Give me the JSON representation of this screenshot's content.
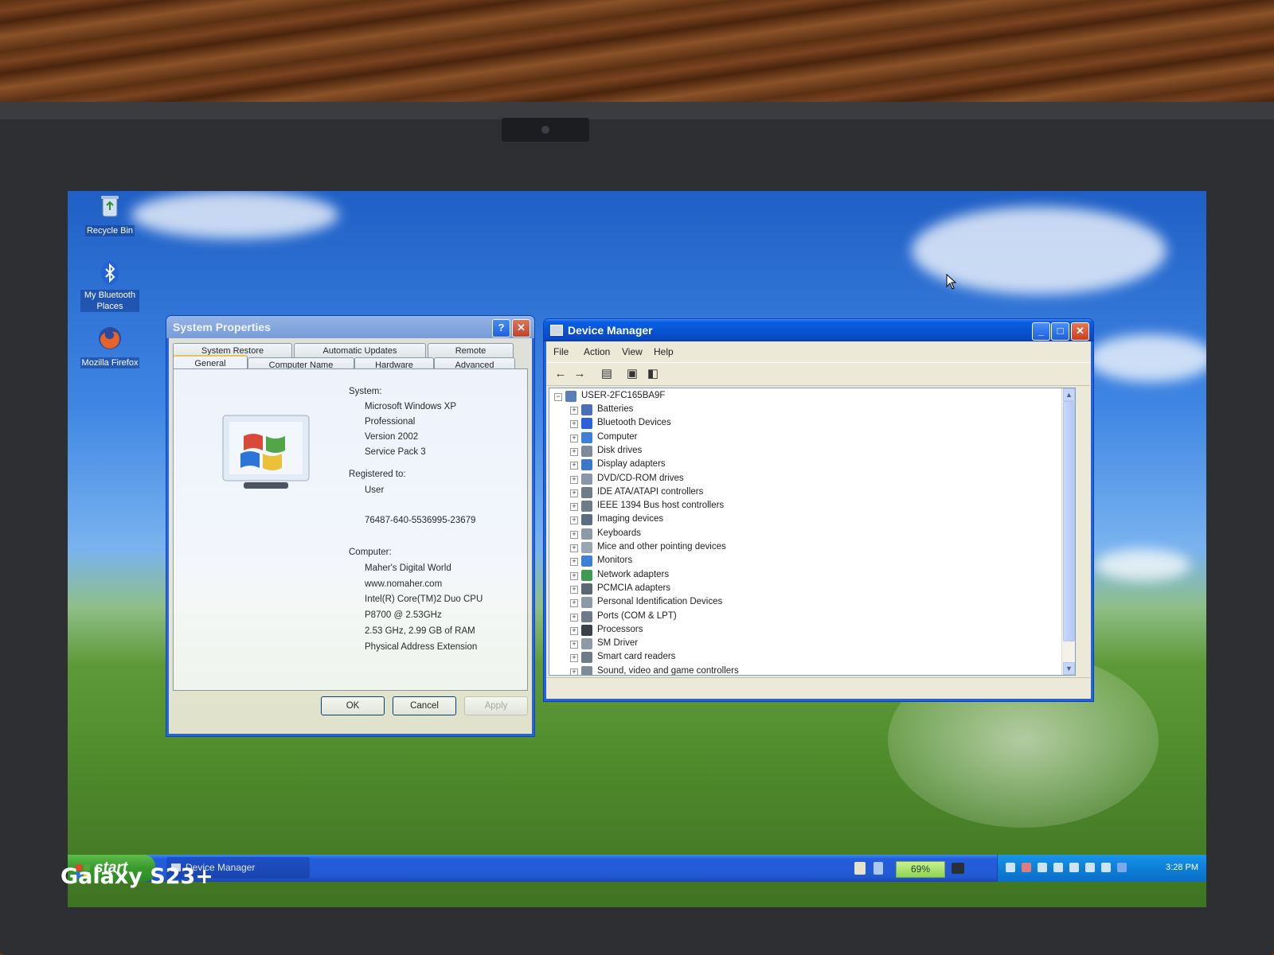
{
  "photo": {
    "watermark": "Galaxy S23+"
  },
  "desktop": {
    "icons": [
      {
        "label": "Recycle Bin",
        "icon": "recycle-bin-icon"
      },
      {
        "label": "My Bluetooth Places",
        "icon": "bluetooth-icon"
      },
      {
        "label": "Mozilla Firefox",
        "icon": "firefox-icon"
      }
    ]
  },
  "system_properties": {
    "title": "System Properties",
    "tabs_top": [
      "System Restore",
      "Automatic Updates",
      "Remote"
    ],
    "tabs_bottom": [
      "General",
      "Computer Name",
      "Hardware",
      "Advanced"
    ],
    "active_tab": "General",
    "system_heading": "System:",
    "system_lines": [
      "Microsoft Windows XP",
      "Professional",
      "Version 2002",
      "Service Pack 3"
    ],
    "registered_heading": "Registered to:",
    "registered_user": "User",
    "product_id": "76487-640-5536995-23679",
    "computer_heading": "Computer:",
    "computer_lines": [
      "Maher's Digital World",
      "www.nomaher.com",
      "Intel(R) Core(TM)2 Duo CPU",
      "P8700  @ 2.53GHz",
      "2.53 GHz, 2.99 GB of RAM",
      "Physical Address Extension"
    ],
    "buttons": {
      "ok": "OK",
      "cancel": "Cancel",
      "apply": "Apply"
    }
  },
  "device_manager": {
    "title": "Device Manager",
    "menu": [
      "File",
      "Action",
      "View",
      "Help"
    ],
    "root": "USER-2FC165BA9F",
    "items": [
      {
        "label": "Batteries",
        "color": "#4a6fb5"
      },
      {
        "label": "Bluetooth Devices",
        "color": "#2b62d9"
      },
      {
        "label": "Computer",
        "color": "#3f7fd6"
      },
      {
        "label": "Disk drives",
        "color": "#7f8a99"
      },
      {
        "label": "Display adapters",
        "color": "#3a78c9"
      },
      {
        "label": "DVD/CD-ROM drives",
        "color": "#8b97a8"
      },
      {
        "label": "IDE ATA/ATAPI controllers",
        "color": "#6f7b89"
      },
      {
        "label": "IEEE 1394 Bus host controllers",
        "color": "#6f7b89"
      },
      {
        "label": "Imaging devices",
        "color": "#5a6d85"
      },
      {
        "label": "Keyboards",
        "color": "#8e99a6"
      },
      {
        "label": "Mice and other pointing devices",
        "color": "#9aa6b2"
      },
      {
        "label": "Monitors",
        "color": "#3f7fd6"
      },
      {
        "label": "Network adapters",
        "color": "#3f9a52"
      },
      {
        "label": "PCMCIA adapters",
        "color": "#5c6775"
      },
      {
        "label": "Personal Identification Devices",
        "color": "#8e99a6"
      },
      {
        "label": "Ports (COM & LPT)",
        "color": "#6f7b89"
      },
      {
        "label": "Processors",
        "color": "#3b3f46"
      },
      {
        "label": "SM Driver",
        "color": "#8e99a6"
      },
      {
        "label": "Smart card readers",
        "color": "#6f7b89"
      },
      {
        "label": "Sound, video and game controllers",
        "color": "#7f8a99"
      }
    ]
  },
  "taskbar": {
    "start_label": "start",
    "task_label": "Device Manager",
    "battery": "69%",
    "clock": "3:28 PM"
  }
}
